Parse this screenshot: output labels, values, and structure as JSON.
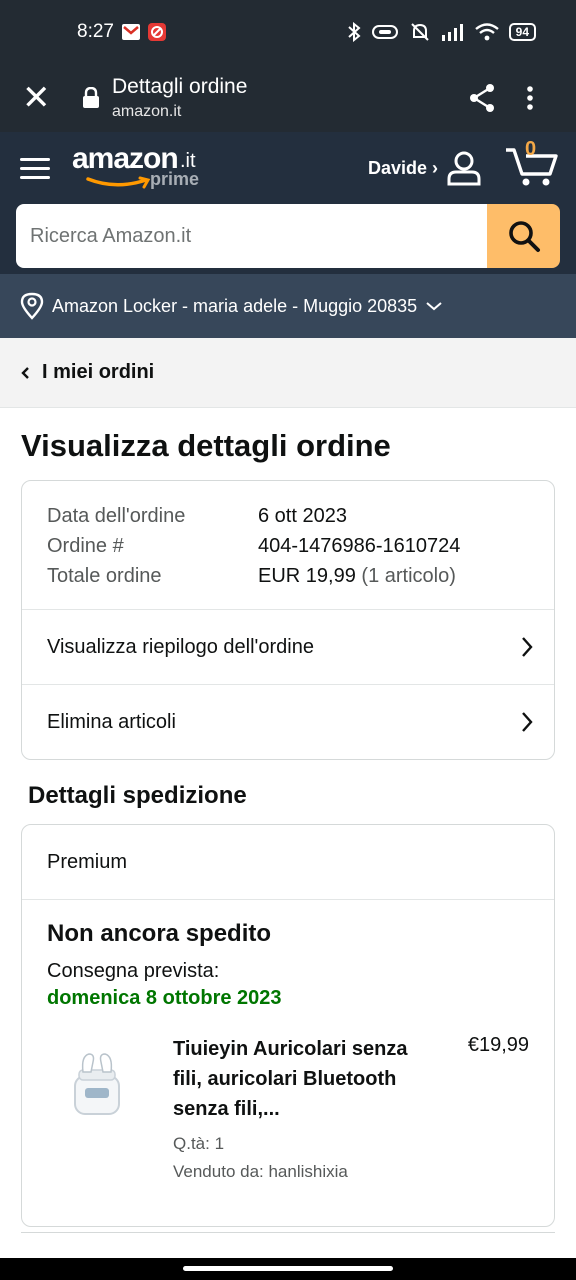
{
  "status_bar": {
    "time": "8:27",
    "battery": "94"
  },
  "browser": {
    "close_label": "✕",
    "title": "Dettagli ordine",
    "url": "amazon.it"
  },
  "header": {
    "logo_word": "amazon",
    "logo_tld": ".it",
    "logo_prime": "prime",
    "account_label": "Davide ›",
    "cart_count": "0",
    "search_placeholder": "Ricerca Amazon.it",
    "location": "Amazon Locker - maria adele - Muggio 20835"
  },
  "breadcrumb": {
    "label": "I miei ordini"
  },
  "page": {
    "title": "Visualizza dettagli ordine"
  },
  "order_summary": {
    "date_label": "Data dell'ordine",
    "date_value": "6 ott 2023",
    "number_label": "Ordine #",
    "number_value": "404-1476986-1610724",
    "total_label": "Totale ordine",
    "total_value": "EUR 19,99",
    "total_items": "(1 articolo)"
  },
  "links": {
    "view_summary": "Visualizza riepilogo dell'ordine",
    "delete_items": "Elimina articoli"
  },
  "shipping": {
    "section_title": "Dettagli spedizione",
    "type": "Premium",
    "status": "Non ancora spedito",
    "eta_label": "Consegna prevista:",
    "eta_date": "domenica 8 ottobre 2023",
    "item": {
      "name": "Tiuieyin Auricolari senza fili, auricolari Bluetooth senza fili,...",
      "quantity": "Q.tà: 1",
      "seller": "Venduto da: hanlishixia",
      "price": "€19,99"
    }
  },
  "colors": {
    "header": "#232f3e",
    "location_bar": "#37475a",
    "search_button": "#febd69",
    "delivery_green": "#007600"
  }
}
